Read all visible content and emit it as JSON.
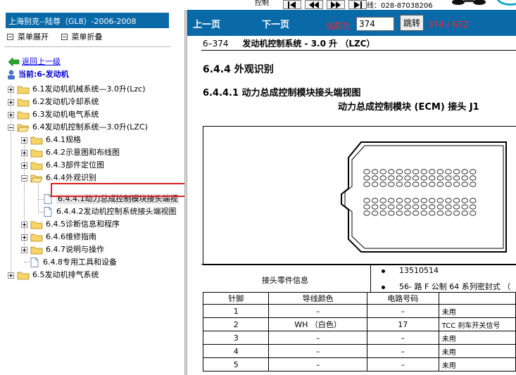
{
  "toolbar": {
    "label_left": "控制",
    "phone_text": "线：028-87038206",
    "colors": {
      "accent_ring": "#17a8c8"
    }
  },
  "left_panel": {
    "title": "上海别克--陆尊（GL8）-2006-2008",
    "expand_all": "菜单展开",
    "collapse_all": "菜单折叠",
    "back_link": "返回上一级",
    "current_node": "当前:6-发动机",
    "tree": [
      {
        "label": "6.1发动机机械系统—3.0升(Lzc)",
        "level": 1,
        "type": "folder",
        "state": "collapsed"
      },
      {
        "label": "6.2发动机冷却系统",
        "level": 1,
        "type": "folder",
        "state": "collapsed"
      },
      {
        "label": "6.3发动机电气系统",
        "level": 1,
        "type": "folder",
        "state": "collapsed"
      },
      {
        "label": "6.4发动机控制系统—3.0升(LZC)",
        "level": 1,
        "type": "folder",
        "state": "expanded"
      },
      {
        "label": "6.4.1规格",
        "level": 2,
        "type": "folder",
        "state": "collapsed"
      },
      {
        "label": "6.4.2示意图和布线图",
        "level": 2,
        "type": "folder",
        "state": "collapsed"
      },
      {
        "label": "6.4.3部件定位图",
        "level": 2,
        "type": "folder",
        "state": "collapsed"
      },
      {
        "label": "6.4.4外观识别",
        "level": 2,
        "type": "folder",
        "state": "expanded"
      },
      {
        "label": "6.4.4.1动力总成控制模块接头端视",
        "level": 3,
        "type": "doc",
        "selected": true
      },
      {
        "label": "6.4.4.2发动机控制系统接头端视图",
        "level": 3,
        "type": "doc"
      },
      {
        "label": "6.4.5诊断信息和程序",
        "level": 2,
        "type": "folder",
        "state": "collapsed"
      },
      {
        "label": "6.4.6维修指南",
        "level": 2,
        "type": "folder",
        "state": "collapsed"
      },
      {
        "label": "6.4.7说明与操作",
        "level": 2,
        "type": "folder",
        "state": "collapsed"
      },
      {
        "label": "6.4.8专用工具和设备",
        "level": 2,
        "type": "doc"
      },
      {
        "label": "6.5发动机排气系统",
        "level": 1,
        "type": "folder",
        "state": "collapsed"
      }
    ]
  },
  "nav": {
    "prev": "上一页",
    "next": "下一页",
    "current_label": "当前为",
    "current_page": "374",
    "jump": "跳转",
    "page_count": "374 / 672"
  },
  "doc": {
    "page_ref": "6–374",
    "running_title": "发动机控制系统 - 3.0 升 （LZC）",
    "section": "6.4.4 外观识别",
    "subsection": "6.4.4.1 动力总成控制模块接头端视图",
    "figure_title": "动力总成控制模块 (ECM) 接头 J1",
    "info_label": "接头零件信息",
    "info_items": [
      "13510514",
      "56- 路 F 公制 64 系列密封式 （"
    ],
    "table": {
      "headers": [
        "针脚",
        "导线颜色",
        "电路号码",
        ""
      ],
      "rows": [
        [
          "1",
          "–",
          "–",
          "未用"
        ],
        [
          "2",
          "WH （白色）",
          "17",
          "TCC 刹车开关信号"
        ],
        [
          "3",
          "–",
          "–",
          "未用"
        ],
        [
          "4",
          "–",
          "–",
          "未用"
        ],
        [
          "5",
          "–",
          "–",
          "未用"
        ]
      ]
    },
    "colors": {
      "nav_bg": "#0a6aa8",
      "highlight": "#e02020"
    }
  }
}
